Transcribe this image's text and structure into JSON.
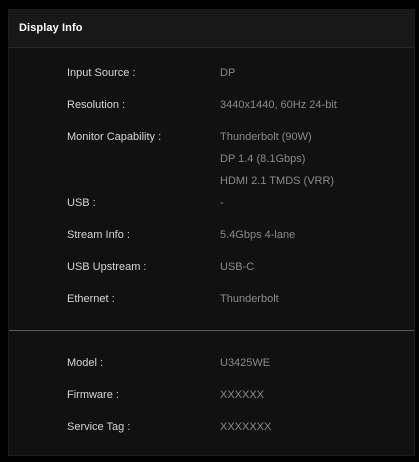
{
  "header": {
    "title": "Display Info"
  },
  "info": {
    "input_source": {
      "label": "Input Source :",
      "value": "DP"
    },
    "resolution": {
      "label": "Resolution :",
      "value": "3440x1440, 60Hz 24-bit"
    },
    "monitor_capability": {
      "label": "Monitor Capability :",
      "values": [
        "Thunderbolt (90W)",
        "DP 1.4 (8.1Gbps)",
        "HDMI 2.1 TMDS (VRR)"
      ]
    },
    "usb": {
      "label": "USB :",
      "value": "-"
    },
    "stream_info": {
      "label": "Stream Info :",
      "value": "5.4Gbps 4-lane"
    },
    "usb_upstream": {
      "label": "USB Upstream :",
      "value": "USB-C"
    },
    "ethernet": {
      "label": "Ethernet :",
      "value": "Thunderbolt"
    }
  },
  "device": {
    "model": {
      "label": "Model :",
      "value": "U3425WE"
    },
    "firmware": {
      "label": "Firmware :",
      "value": "XXXXXX"
    },
    "service_tag": {
      "label": "Service Tag :",
      "value": "XXXXXXX"
    }
  },
  "colors": {
    "background": "#000000",
    "panel": "#111111",
    "label_text": "#d6d6d6",
    "value_text": "#8a8a8a",
    "divider": "#5a5a5a"
  }
}
